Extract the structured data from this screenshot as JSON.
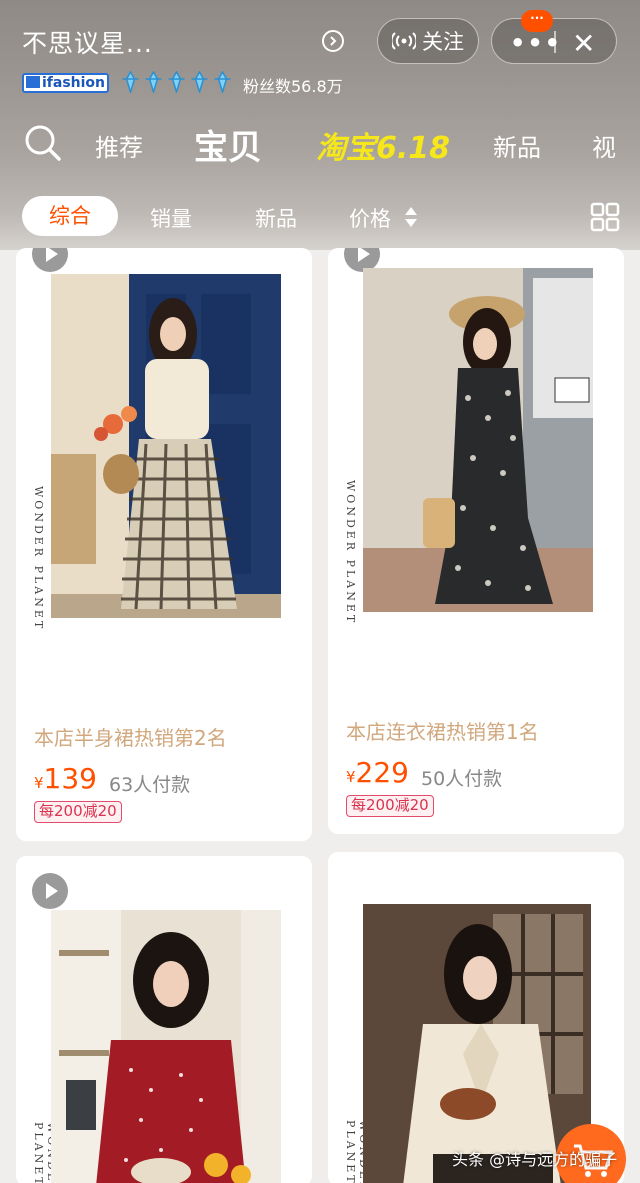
{
  "header": {
    "store_name": "不思议星...",
    "follow_label": "关注",
    "more_label": "•••",
    "close_label": "✕",
    "notif_badge": "···",
    "ifashion_label": "ifashion",
    "fans_text": "粉丝数56.8万"
  },
  "nav": {
    "tabs": [
      {
        "label": "推荐"
      },
      {
        "label": "宝贝"
      },
      {
        "label": "淘宝6.18"
      },
      {
        "label": "新品"
      },
      {
        "label": "视"
      }
    ]
  },
  "filters": {
    "items": [
      {
        "label": "综合"
      },
      {
        "label": "销量"
      },
      {
        "label": "新品"
      },
      {
        "label": "价格"
      }
    ]
  },
  "products": [
    {
      "title": "本店半身裙热销第2名",
      "currency": "¥",
      "price": "139",
      "sold": "63人付款",
      "coupon": "每200减20",
      "brand": "WONDER PLANET"
    },
    {
      "title": "本店连衣裙热销第1名",
      "currency": "¥",
      "price": "229",
      "sold": "50人付款",
      "coupon": "每200减20",
      "brand": "WONDER PLANET"
    },
    {
      "brand": "WONDER PLANET"
    },
    {
      "brand": "WONDER PLANET"
    }
  ],
  "watermark": "头条 @诗与远方的骗子",
  "colors": {
    "accent": "#ff5000",
    "title_gold": "#d1a87e",
    "coupon_red": "#d9334f",
    "tb618_yellow": "#f6e71a"
  }
}
